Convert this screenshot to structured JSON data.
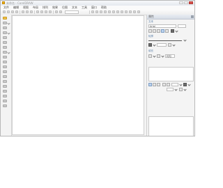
{
  "window": {
    "title": "未命名 - CorelDRAW"
  },
  "menu": {
    "items": [
      "文件",
      "编辑",
      "视图",
      "布局",
      "排列",
      "效果",
      "位图",
      "文本",
      "工具",
      "窗口",
      "帮助"
    ]
  },
  "toolbar": {
    "zoom_value": "100%"
  },
  "right_panel": {
    "title": "属性",
    "section_text": "文本",
    "font_value": "Arial",
    "section_outline": "轮廓",
    "section_fill": "填充",
    "fill_value": "均匀"
  },
  "colors": {
    "active_tool": "#f2c44a",
    "close_button": "#d9524d",
    "section_label": "#5a7fa8"
  }
}
